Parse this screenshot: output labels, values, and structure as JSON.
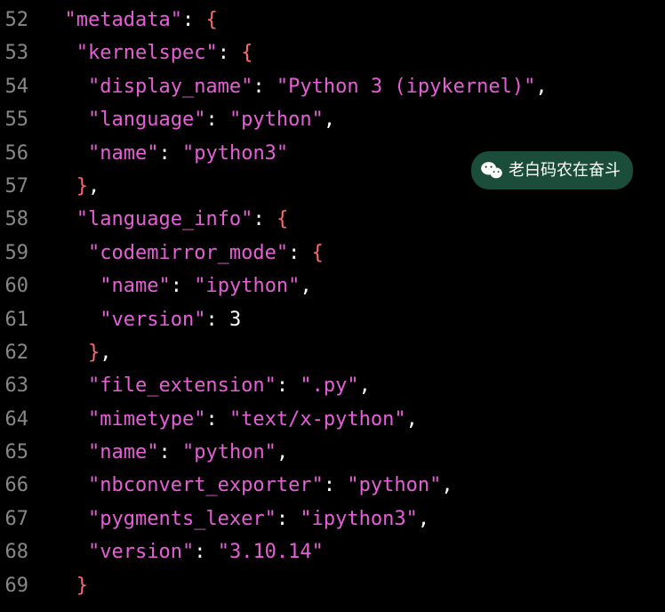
{
  "lines": [
    {
      "num": "52",
      "parts": [
        {
          "t": "  ",
          "c": "punct"
        },
        {
          "t": "\"metadata\"",
          "c": "key"
        },
        {
          "t": ": ",
          "c": "punct"
        },
        {
          "t": "{",
          "c": "brace"
        }
      ]
    },
    {
      "num": "53",
      "parts": [
        {
          "t": "   ",
          "c": "punct"
        },
        {
          "t": "\"kernelspec\"",
          "c": "key"
        },
        {
          "t": ": ",
          "c": "punct"
        },
        {
          "t": "{",
          "c": "brace"
        }
      ]
    },
    {
      "num": "54",
      "parts": [
        {
          "t": "    ",
          "c": "punct"
        },
        {
          "t": "\"display_name\"",
          "c": "key"
        },
        {
          "t": ": ",
          "c": "punct"
        },
        {
          "t": "\"Python 3 (ipykernel)\"",
          "c": "string"
        },
        {
          "t": ",",
          "c": "punct"
        }
      ]
    },
    {
      "num": "55",
      "parts": [
        {
          "t": "    ",
          "c": "punct"
        },
        {
          "t": "\"language\"",
          "c": "key"
        },
        {
          "t": ": ",
          "c": "punct"
        },
        {
          "t": "\"python\"",
          "c": "string"
        },
        {
          "t": ",",
          "c": "punct"
        }
      ]
    },
    {
      "num": "56",
      "parts": [
        {
          "t": "    ",
          "c": "punct"
        },
        {
          "t": "\"name\"",
          "c": "key"
        },
        {
          "t": ": ",
          "c": "punct"
        },
        {
          "t": "\"python3\"",
          "c": "string"
        }
      ]
    },
    {
      "num": "57",
      "parts": [
        {
          "t": "   ",
          "c": "punct"
        },
        {
          "t": "}",
          "c": "brace"
        },
        {
          "t": ",",
          "c": "punct"
        }
      ]
    },
    {
      "num": "58",
      "parts": [
        {
          "t": "   ",
          "c": "punct"
        },
        {
          "t": "\"language_info\"",
          "c": "key"
        },
        {
          "t": ": ",
          "c": "punct"
        },
        {
          "t": "{",
          "c": "brace"
        }
      ]
    },
    {
      "num": "59",
      "parts": [
        {
          "t": "    ",
          "c": "punct"
        },
        {
          "t": "\"codemirror_mode\"",
          "c": "key"
        },
        {
          "t": ": ",
          "c": "punct"
        },
        {
          "t": "{",
          "c": "brace"
        }
      ]
    },
    {
      "num": "60",
      "parts": [
        {
          "t": "     ",
          "c": "punct"
        },
        {
          "t": "\"name\"",
          "c": "key"
        },
        {
          "t": ": ",
          "c": "punct"
        },
        {
          "t": "\"ipython\"",
          "c": "string"
        },
        {
          "t": ",",
          "c": "punct"
        }
      ]
    },
    {
      "num": "61",
      "parts": [
        {
          "t": "     ",
          "c": "punct"
        },
        {
          "t": "\"version\"",
          "c": "key"
        },
        {
          "t": ": ",
          "c": "punct"
        },
        {
          "t": "3",
          "c": "number"
        }
      ]
    },
    {
      "num": "62",
      "parts": [
        {
          "t": "    ",
          "c": "punct"
        },
        {
          "t": "}",
          "c": "brace"
        },
        {
          "t": ",",
          "c": "punct"
        }
      ]
    },
    {
      "num": "63",
      "parts": [
        {
          "t": "    ",
          "c": "punct"
        },
        {
          "t": "\"file_extension\"",
          "c": "key"
        },
        {
          "t": ": ",
          "c": "punct"
        },
        {
          "t": "\".py\"",
          "c": "string"
        },
        {
          "t": ",",
          "c": "punct"
        }
      ]
    },
    {
      "num": "64",
      "parts": [
        {
          "t": "    ",
          "c": "punct"
        },
        {
          "t": "\"mimetype\"",
          "c": "key"
        },
        {
          "t": ": ",
          "c": "punct"
        },
        {
          "t": "\"text/x-python\"",
          "c": "string"
        },
        {
          "t": ",",
          "c": "punct"
        }
      ]
    },
    {
      "num": "65",
      "parts": [
        {
          "t": "    ",
          "c": "punct"
        },
        {
          "t": "\"name\"",
          "c": "key"
        },
        {
          "t": ": ",
          "c": "punct"
        },
        {
          "t": "\"python\"",
          "c": "string"
        },
        {
          "t": ",",
          "c": "punct"
        }
      ]
    },
    {
      "num": "66",
      "parts": [
        {
          "t": "    ",
          "c": "punct"
        },
        {
          "t": "\"nbconvert_exporter\"",
          "c": "key"
        },
        {
          "t": ": ",
          "c": "punct"
        },
        {
          "t": "\"python\"",
          "c": "string"
        },
        {
          "t": ",",
          "c": "punct"
        }
      ]
    },
    {
      "num": "67",
      "parts": [
        {
          "t": "    ",
          "c": "punct"
        },
        {
          "t": "\"pygments_lexer\"",
          "c": "key"
        },
        {
          "t": ": ",
          "c": "punct"
        },
        {
          "t": "\"ipython3\"",
          "c": "string"
        },
        {
          "t": ",",
          "c": "punct"
        }
      ]
    },
    {
      "num": "68",
      "parts": [
        {
          "t": "    ",
          "c": "punct"
        },
        {
          "t": "\"version\"",
          "c": "key"
        },
        {
          "t": ": ",
          "c": "punct"
        },
        {
          "t": "\"3.10.14\"",
          "c": "string"
        }
      ]
    },
    {
      "num": "69",
      "parts": [
        {
          "t": "   ",
          "c": "punct"
        },
        {
          "t": "}",
          "c": "brace"
        }
      ]
    }
  ],
  "watermark": {
    "text": "老白码农在奋斗"
  }
}
